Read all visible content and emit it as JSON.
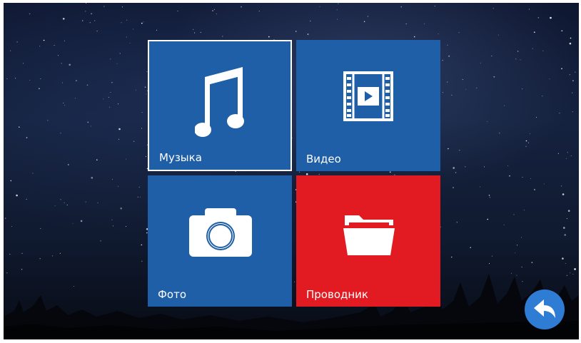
{
  "tiles": [
    {
      "label": "Музыка",
      "icon": "music-note-icon",
      "color": "#1e5fa8",
      "selected": true
    },
    {
      "label": "Видео",
      "icon": "film-play-icon",
      "color": "#1e5fa8",
      "selected": false
    },
    {
      "label": "Фото",
      "icon": "camera-icon",
      "color": "#1e5fa8",
      "selected": false
    },
    {
      "label": "Проводник",
      "icon": "folder-open-icon",
      "color": "#e21a22",
      "selected": false
    }
  ],
  "back_button": {
    "icon": "back-arrow-icon",
    "color": "#2f7cd4"
  }
}
